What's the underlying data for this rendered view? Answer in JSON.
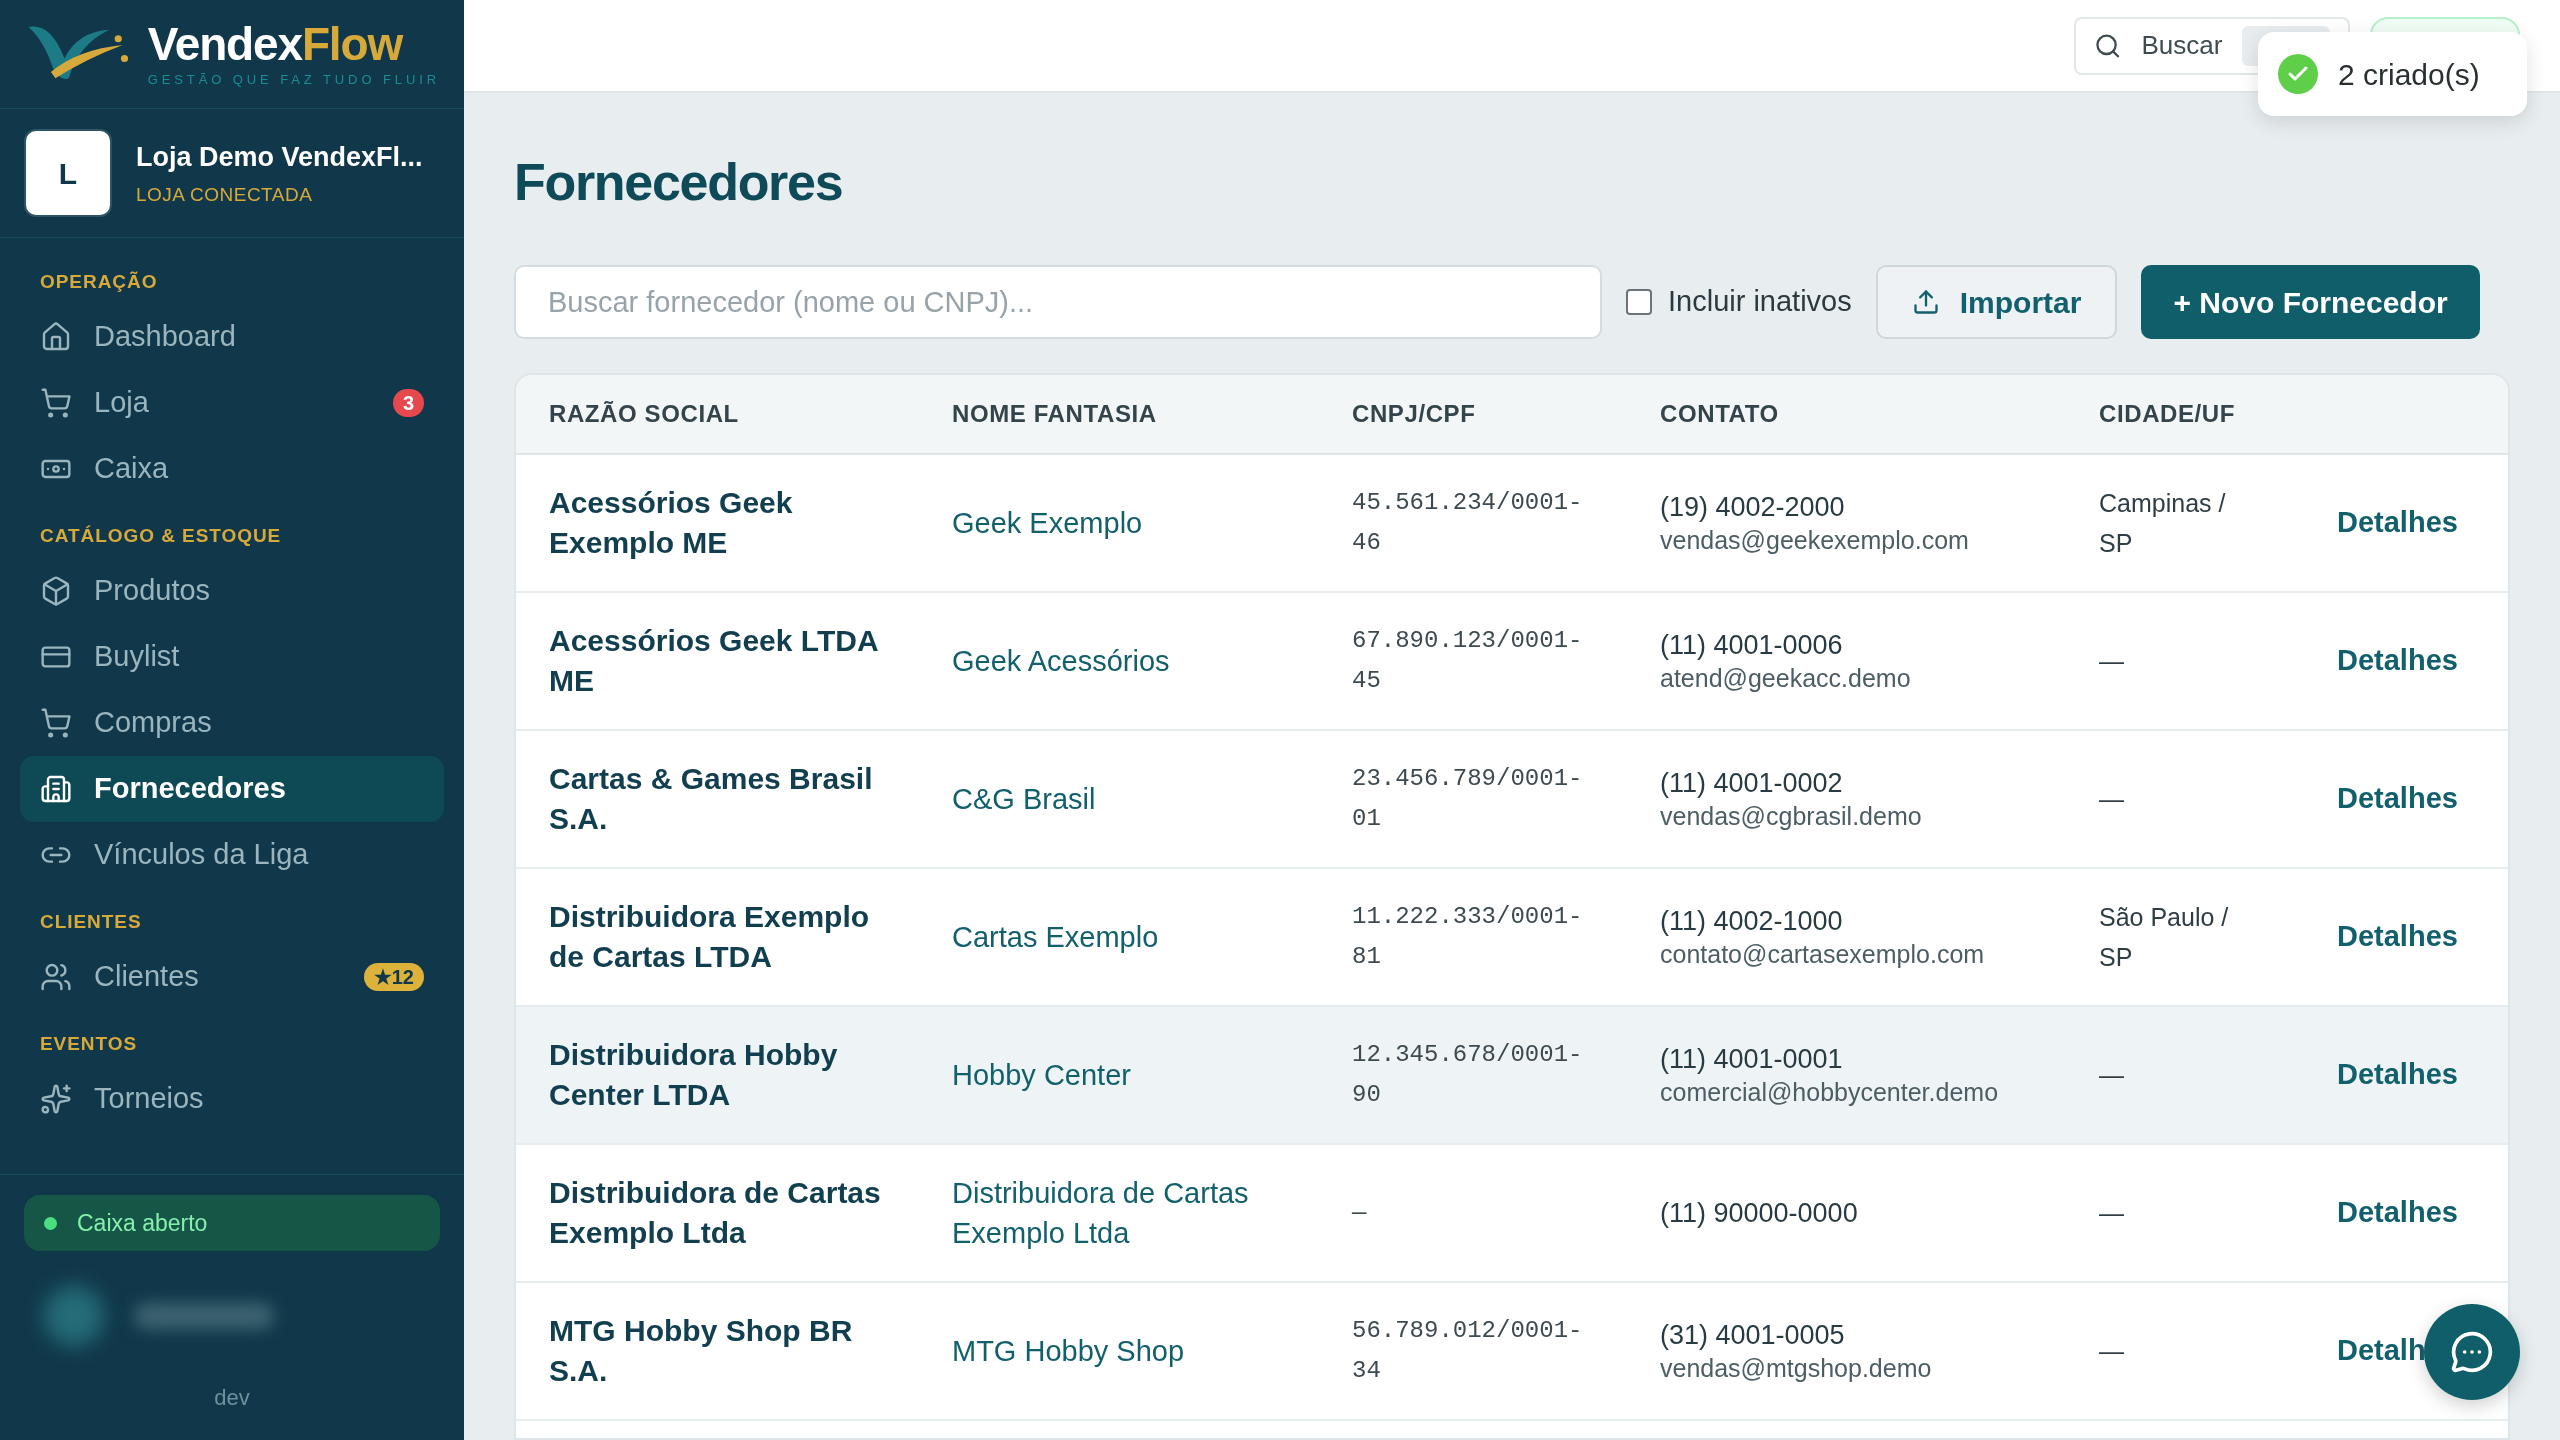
{
  "brand": {
    "name_a": "Vendex",
    "name_b": "Flow",
    "tagline": "GESTÃO QUE FAZ TUDO FLUIR"
  },
  "store": {
    "initial": "L",
    "name": "Loja Demo VendexFl...",
    "status": "LOJA CONECTADA"
  },
  "sidebar": {
    "sections": [
      {
        "title": "OPERAÇÃO",
        "items": [
          {
            "label": "Dashboard",
            "selected": false
          },
          {
            "label": "Loja",
            "selected": false,
            "badge": {
              "text": "3",
              "color": "#e5484d"
            }
          },
          {
            "label": "Caixa",
            "selected": false
          }
        ]
      },
      {
        "title": "CATÁLOGO & ESTOQUE",
        "items": [
          {
            "label": "Produtos",
            "selected": false
          },
          {
            "label": "Buylist",
            "selected": false
          },
          {
            "label": "Compras",
            "selected": false
          },
          {
            "label": "Fornecedores",
            "selected": true
          },
          {
            "label": "Vínculos da Liga",
            "selected": false
          }
        ]
      },
      {
        "title": "CLIENTES",
        "items": [
          {
            "label": "Clientes",
            "selected": false,
            "badge": {
              "text": "★12",
              "color": "#dcb23a"
            }
          }
        ]
      },
      {
        "title": "EVENTOS",
        "items": [
          {
            "label": "Torneios",
            "selected": false
          }
        ]
      }
    ],
    "cash_status": "Caixa aberto",
    "footer": "dev"
  },
  "topbar": {
    "search_label": "Buscar"
  },
  "toast": {
    "text": "2 criado(s)"
  },
  "page": {
    "title": "Fornecedores",
    "search": {
      "placeholder": "Buscar fornecedor (nome ou CNPJ)..."
    },
    "include_inactive": {
      "label": "Incluir inativos",
      "checked": false
    },
    "import_button": "Importar",
    "new_button": "+ Novo Fornecedor"
  },
  "table": {
    "columns": [
      "RAZÃO SOCIAL",
      "NOME FANTASIA",
      "CNPJ/CPF",
      "CONTATO",
      "CIDADE/UF"
    ],
    "rows": [
      {
        "razao": "Acessórios Geek Exemplo ME",
        "fantasia": "Geek Exemplo",
        "cnpj": "45.561.234/0001-46",
        "phone": "(19) 4002-2000",
        "email": "vendas@geekexemplo.com",
        "city": "Campinas / SP",
        "action": "Detalhes",
        "highlighted": false
      },
      {
        "razao": "Acessórios Geek LTDA ME",
        "fantasia": "Geek Acessórios",
        "cnpj": "67.890.123/0001-45",
        "phone": "(11) 4001-0006",
        "email": "atend@geekacc.demo",
        "city": "—",
        "action": "Detalhes",
        "highlighted": false
      },
      {
        "razao": "Cartas & Games Brasil S.A.",
        "fantasia": "C&G Brasil",
        "cnpj": "23.456.789/0001-01",
        "phone": "(11) 4001-0002",
        "email": "vendas@cgbrasil.demo",
        "city": "—",
        "action": "Detalhes",
        "highlighted": false
      },
      {
        "razao": "Distribuidora Exemplo de Cartas LTDA",
        "fantasia": "Cartas Exemplo",
        "cnpj": "11.222.333/0001-81",
        "phone": "(11) 4002-1000",
        "email": "contato@cartasexemplo.com",
        "city": "São Paulo / SP",
        "action": "Detalhes",
        "highlighted": false
      },
      {
        "razao": "Distribuidora Hobby Center LTDA",
        "fantasia": "Hobby Center",
        "cnpj": "12.345.678/0001-90",
        "phone": "(11) 4001-0001",
        "email": "comercial@hobbycenter.demo",
        "city": "—",
        "action": "Detalhes",
        "highlighted": true
      },
      {
        "razao": "Distribuidora de Cartas Exemplo Ltda",
        "fantasia": "Distribuidora de Cartas Exemplo Ltda",
        "cnpj": "—",
        "phone": "(11) 90000-0000",
        "city": "—",
        "action": "Detalhes",
        "highlighted": false
      },
      {
        "razao": "MTG Hobby Shop BR S.A.",
        "fantasia": "MTG Hobby Shop",
        "cnpj": "56.789.012/0001-34",
        "phone": "(31) 4001-0005",
        "email": "vendas@mtgshop.demo",
        "city": "—",
        "action": "Detalh",
        "highlighted": false
      }
    ]
  }
}
